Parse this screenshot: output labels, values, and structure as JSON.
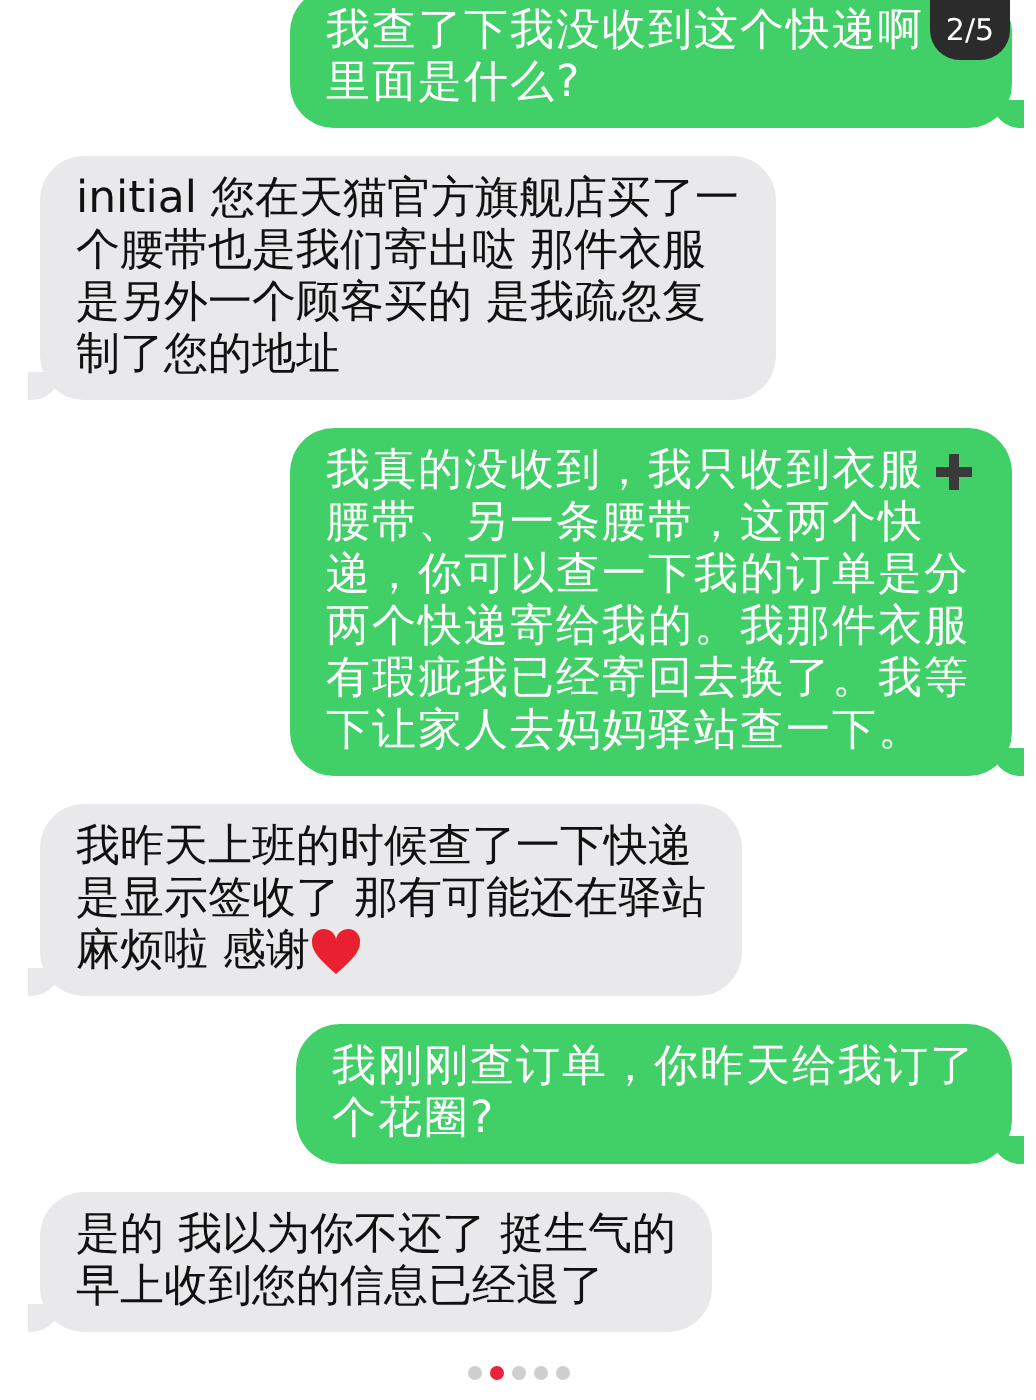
{
  "page_counter": "2/5",
  "messages": [
    {
      "kind": "sent",
      "lines": [
        {
          "text": "我查了下我没收到这个快递啊"
        },
        {
          "text": "里面是什么?"
        }
      ]
    },
    {
      "kind": "received",
      "lines": [
        {
          "text": "initial 您在天猫官方旗舰店买了一"
        },
        {
          "text": "个腰带也是我们寄出哒 那件衣服"
        },
        {
          "text": "是另外一个顾客买的 是我疏忽复"
        },
        {
          "text": "制了您的地址"
        }
      ]
    },
    {
      "kind": "sent",
      "lines": [
        {
          "text": "我真的没收到，我只收到衣服",
          "icon_after": true
        },
        {
          "text": "腰带、另一条腰带，这两个快"
        },
        {
          "text": "递，你可以查一下我的订单是分"
        },
        {
          "text": "两个快递寄给我的。我那件衣服"
        },
        {
          "text": "有瑕疵我已经寄回去换了。我等"
        },
        {
          "text": "下让家人去妈妈驿站查一下。"
        }
      ]
    },
    {
      "kind": "received",
      "lines": [
        {
          "text": "我昨天上班的时候查了一下快递"
        },
        {
          "text": "是显示签收了 那有可能还在驿站"
        },
        {
          "text": "麻烦啦 感谢",
          "icon_after": true
        }
      ]
    },
    {
      "kind": "sent",
      "lines": [
        {
          "text": "我刚刚查订单，你昨天给我订了"
        },
        {
          "text": "个花圈?"
        }
      ]
    },
    {
      "kind": "received",
      "lines": [
        {
          "text": "是的 我以为你不还了 挺生气的"
        },
        {
          "text": "早上收到您的信息已经退了"
        }
      ]
    }
  ],
  "dots": [
    {
      "selected": false
    },
    {
      "selected": true
    },
    {
      "selected": false
    },
    {
      "selected": false
    },
    {
      "selected": false
    }
  ]
}
